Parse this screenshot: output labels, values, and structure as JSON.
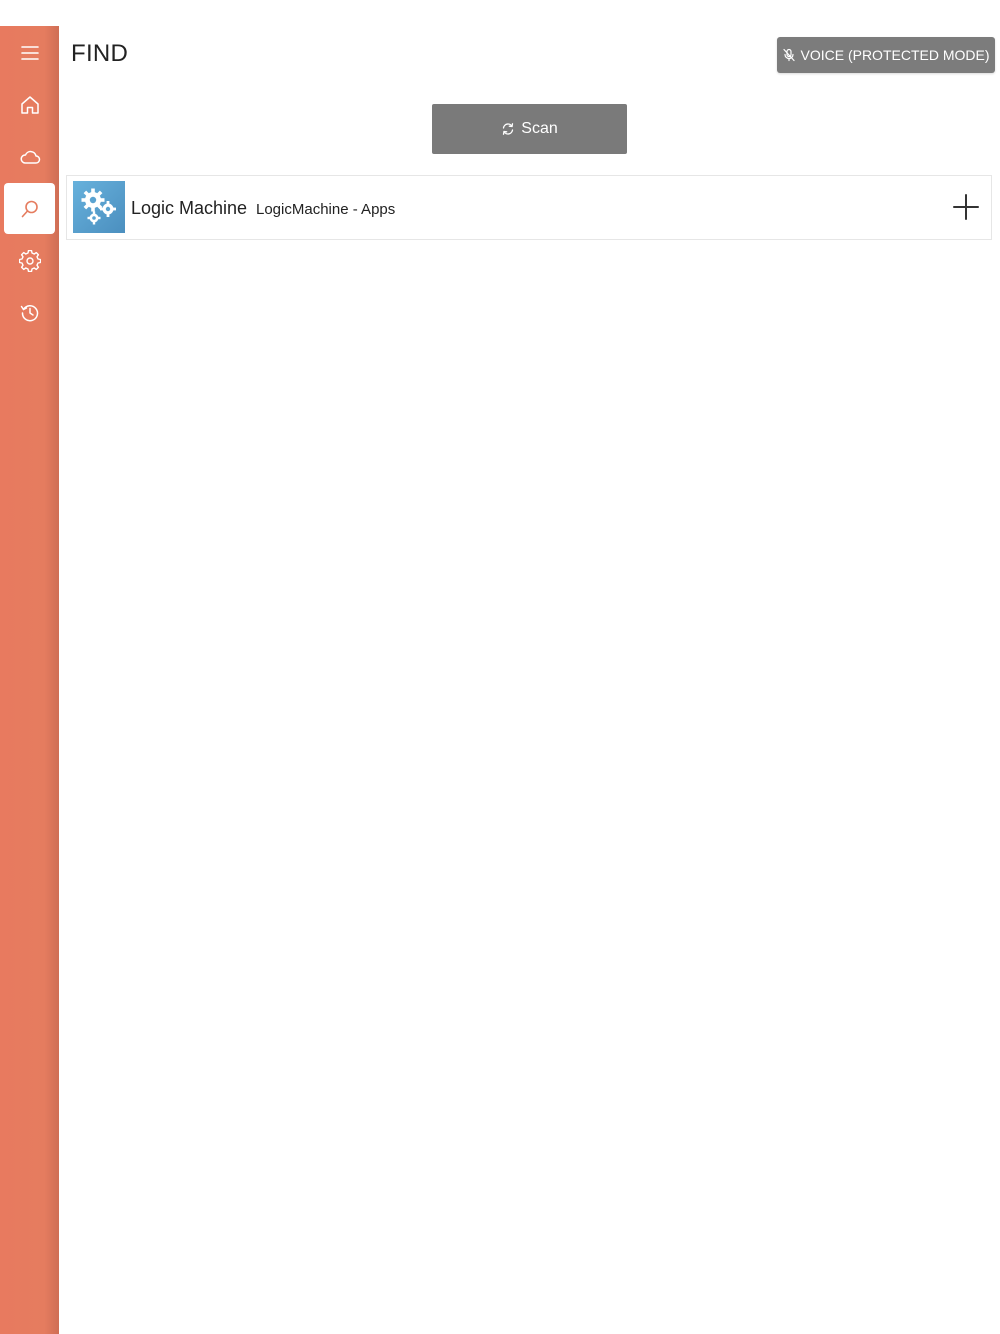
{
  "sidebar": {
    "items": [
      {
        "id": "menu",
        "icon": "hamburger-menu-icon"
      },
      {
        "id": "home",
        "icon": "home-icon"
      },
      {
        "id": "cloud",
        "icon": "cloud-icon"
      },
      {
        "id": "find",
        "icon": "search-icon",
        "active": true
      },
      {
        "id": "settings",
        "icon": "gear-icon"
      },
      {
        "id": "history",
        "icon": "history-icon"
      }
    ],
    "accent_color": "#e57c5f"
  },
  "header": {
    "title": "FIND",
    "voice_button_label": "VOICE (PROTECTED MODE)",
    "voice_button_icon": "microphone-off-icon"
  },
  "scan": {
    "label": "Scan",
    "icon": "refresh-icon"
  },
  "devices": [
    {
      "name": "Logic Machine",
      "subtitle": "LogicMachine - Apps",
      "thumbnail_icon": "gears-icon",
      "action_icon": "plus-icon"
    }
  ]
}
